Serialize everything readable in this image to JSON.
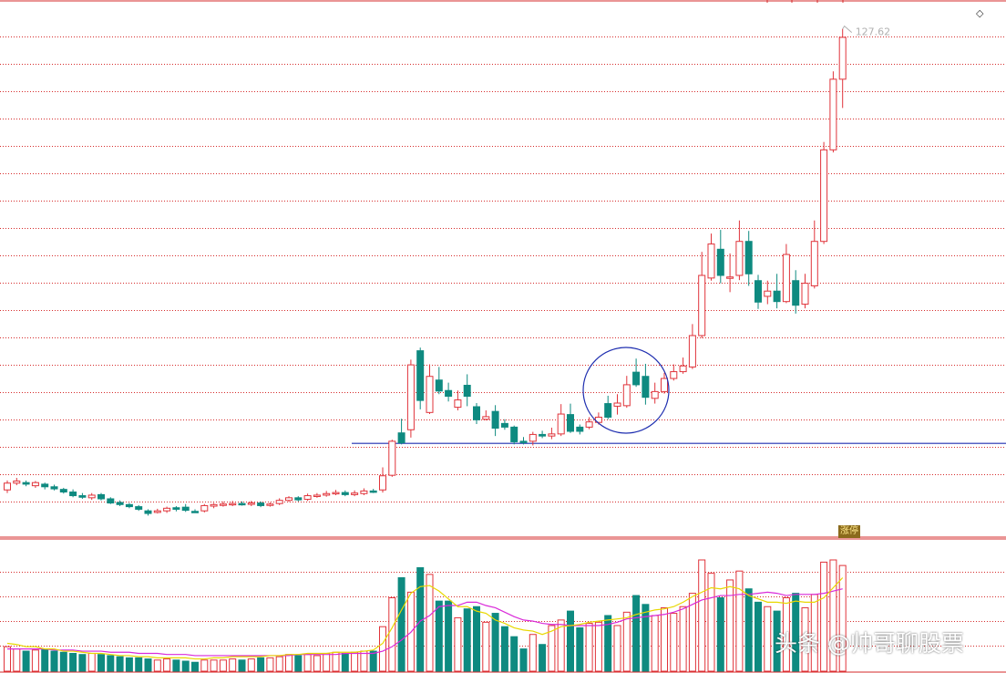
{
  "colors": {
    "up": "#e0333a",
    "down": "#0e8a80",
    "grid": "#d62b2b",
    "ma_fast": "#e8d800",
    "ma_slow": "#d92ad9",
    "support": "#1f2fb0",
    "circle": "#1f2fb0"
  },
  "price_axis": {
    "min": 31,
    "max": 130
  },
  "volume_axis": {
    "max": 100
  },
  "annotations": {
    "high_label": "127.62",
    "badge": "涨停",
    "watermark": "头条 @帅哥聊股票",
    "support_level": 48.4
  },
  "chart_data": {
    "type": "candlestick",
    "title": "",
    "ylim": [
      31,
      130
    ],
    "grid": true,
    "max_price_label": "127.62",
    "candles": [
      [
        39.5,
        40.8,
        41.3,
        38.9,
        22,
        "up"
      ],
      [
        40.8,
        41.2,
        41.8,
        40.4,
        20,
        "up"
      ],
      [
        40.9,
        40.6,
        41.3,
        40.2,
        18,
        "down"
      ],
      [
        40.3,
        40.9,
        41.2,
        39.9,
        19,
        "up"
      ],
      [
        40.6,
        40.1,
        40.9,
        39.6,
        20,
        "down"
      ],
      [
        40.1,
        39.7,
        40.5,
        39.4,
        18,
        "down"
      ],
      [
        39.6,
        39.1,
        39.9,
        38.8,
        17,
        "down"
      ],
      [
        39.1,
        38.4,
        39.6,
        38.1,
        16,
        "down"
      ],
      [
        38.4,
        38.1,
        38.9,
        37.8,
        15,
        "down"
      ],
      [
        38.0,
        38.5,
        38.9,
        37.6,
        16,
        "up"
      ],
      [
        38.6,
        37.8,
        38.9,
        37.5,
        15,
        "down"
      ],
      [
        37.8,
        37.0,
        38.1,
        36.8,
        14,
        "down"
      ],
      [
        37.1,
        36.7,
        37.5,
        36.4,
        13,
        "down"
      ],
      [
        36.7,
        36.3,
        37.0,
        36.0,
        12,
        "down"
      ],
      [
        36.3,
        35.8,
        36.6,
        35.5,
        12,
        "down"
      ],
      [
        35.5,
        35.0,
        35.8,
        34.6,
        11,
        "down"
      ],
      [
        35.2,
        35.5,
        35.9,
        35.0,
        10,
        "up"
      ],
      [
        35.5,
        36.0,
        36.3,
        35.1,
        11,
        "up"
      ],
      [
        36.1,
        35.8,
        36.4,
        35.4,
        10,
        "down"
      ],
      [
        36.2,
        35.6,
        36.8,
        35.3,
        9,
        "down"
      ],
      [
        35.4,
        35.4,
        35.8,
        35.1,
        8,
        "down"
      ],
      [
        35.5,
        36.5,
        36.8,
        35.2,
        10,
        "up"
      ],
      [
        36.4,
        36.7,
        37.0,
        36.0,
        10,
        "up"
      ],
      [
        36.7,
        36.8,
        37.3,
        36.3,
        10,
        "up"
      ],
      [
        36.8,
        36.9,
        37.4,
        36.4,
        11,
        "up"
      ],
      [
        36.9,
        36.8,
        37.3,
        36.5,
        10,
        "down"
      ],
      [
        36.8,
        37.0,
        37.4,
        36.4,
        11,
        "up"
      ],
      [
        37.0,
        36.5,
        37.3,
        36.2,
        12,
        "down"
      ],
      [
        36.6,
        36.8,
        37.1,
        36.3,
        12,
        "up"
      ],
      [
        36.9,
        37.5,
        37.9,
        36.6,
        13,
        "up"
      ],
      [
        37.5,
        38.0,
        38.3,
        37.2,
        15,
        "up"
      ],
      [
        38.0,
        37.6,
        38.3,
        37.3,
        14,
        "down"
      ],
      [
        37.7,
        38.4,
        38.8,
        37.4,
        15,
        "up"
      ],
      [
        38.4,
        38.5,
        38.9,
        38.0,
        14,
        "up"
      ],
      [
        38.5,
        38.8,
        39.3,
        38.2,
        16,
        "up"
      ],
      [
        38.8,
        39.0,
        39.5,
        38.5,
        17,
        "up"
      ],
      [
        39.0,
        38.6,
        39.4,
        38.3,
        16,
        "down"
      ],
      [
        38.6,
        38.9,
        39.4,
        38.3,
        17,
        "up"
      ],
      [
        38.8,
        39.3,
        39.8,
        38.5,
        18,
        "up"
      ],
      [
        39.3,
        39.2,
        39.7,
        38.9,
        18,
        "down"
      ],
      [
        39.5,
        42.2,
        43.8,
        39.0,
        40,
        "up"
      ],
      [
        42.3,
        48.8,
        49.1,
        42.0,
        66,
        "up"
      ],
      [
        48.5,
        50.4,
        53.1,
        48.2,
        84,
        "down"
      ],
      [
        51.0,
        63.4,
        64.4,
        49.5,
        71,
        "up"
      ],
      [
        56.6,
        66.1,
        66.7,
        54.9,
        93,
        "down"
      ],
      [
        54.3,
        61.2,
        63.5,
        54.0,
        87,
        "up"
      ],
      [
        60.5,
        58.4,
        63.0,
        57.8,
        63,
        "down"
      ],
      [
        58.5,
        57.4,
        60.0,
        56.4,
        63,
        "down"
      ],
      [
        55.3,
        56.7,
        58.5,
        54.7,
        48,
        "up"
      ],
      [
        57.4,
        59.5,
        61.6,
        55.5,
        56,
        "down"
      ],
      [
        55.4,
        52.9,
        56.1,
        52.1,
        58,
        "down"
      ],
      [
        53.0,
        53.5,
        54.7,
        52.8,
        44,
        "up"
      ],
      [
        54.5,
        51.3,
        55.7,
        49.8,
        52,
        "down"
      ],
      [
        52.2,
        51.5,
        53.0,
        51.0,
        40,
        "down"
      ],
      [
        51.5,
        48.7,
        51.8,
        48.2,
        31,
        "down"
      ],
      [
        48.8,
        48.8,
        49.6,
        48.2,
        20,
        "down"
      ],
      [
        48.8,
        50.1,
        50.6,
        48.0,
        33,
        "up"
      ],
      [
        50.1,
        49.8,
        50.8,
        49.4,
        24,
        "down"
      ],
      [
        49.8,
        50.2,
        51.4,
        49.2,
        41,
        "up"
      ],
      [
        50.2,
        54.0,
        55.9,
        49.8,
        46,
        "up"
      ],
      [
        53.9,
        50.7,
        56.0,
        50.4,
        54,
        "down"
      ],
      [
        50.7,
        51.5,
        52.0,
        50.1,
        39,
        "down"
      ],
      [
        51.5,
        52.5,
        53.4,
        51.1,
        43,
        "up"
      ],
      [
        52.4,
        53.4,
        54.3,
        52.0,
        44,
        "up"
      ],
      [
        53.4,
        56.0,
        57.5,
        53.0,
        50,
        "down"
      ],
      [
        56.1,
        55.5,
        57.8,
        53.9,
        41,
        "up"
      ],
      [
        55.6,
        59.6,
        61.3,
        55.2,
        53,
        "up"
      ],
      [
        59.6,
        62.0,
        64.6,
        59.2,
        68,
        "down"
      ],
      [
        61.2,
        57.2,
        63.6,
        55.8,
        60,
        "down"
      ],
      [
        57.0,
        58.3,
        60.0,
        56.0,
        50,
        "up"
      ],
      [
        58.3,
        60.8,
        61.9,
        57.9,
        57,
        "up"
      ],
      [
        60.8,
        62.1,
        63.5,
        60.4,
        52,
        "up"
      ],
      [
        62.1,
        63.2,
        64.8,
        61.7,
        58,
        "up"
      ],
      [
        63.0,
        69.0,
        71.2,
        62.6,
        70,
        "up"
      ],
      [
        69.0,
        80.5,
        85.0,
        68.5,
        100,
        "up"
      ],
      [
        80.0,
        86.5,
        88.5,
        79.5,
        88,
        "up"
      ],
      [
        85.5,
        80.5,
        89.2,
        79.0,
        66,
        "down"
      ],
      [
        80.0,
        80.2,
        84.7,
        77.3,
        82,
        "up"
      ],
      [
        80.5,
        87.0,
        91.0,
        79.6,
        90,
        "up"
      ],
      [
        87.0,
        80.8,
        89.0,
        78.5,
        74,
        "down"
      ],
      [
        79.5,
        75.4,
        80.6,
        74.1,
        62,
        "down"
      ],
      [
        76.5,
        77.5,
        79.5,
        75.0,
        58,
        "up"
      ],
      [
        77.5,
        75.5,
        80.8,
        74.2,
        54,
        "down"
      ],
      [
        75.5,
        84.5,
        86.5,
        75.2,
        66,
        "up"
      ],
      [
        79.5,
        74.8,
        81.5,
        73.2,
        70,
        "down"
      ],
      [
        75.0,
        79.0,
        80.8,
        74.2,
        57,
        "up"
      ],
      [
        78.5,
        87.0,
        91.0,
        78.0,
        69,
        "up"
      ],
      [
        87.0,
        104.5,
        106.0,
        86.5,
        98,
        "up"
      ],
      [
        104.5,
        118.0,
        119.5,
        104.0,
        100,
        "up"
      ],
      [
        118.0,
        126.0,
        127.62,
        112.5,
        95,
        "up"
      ]
    ],
    "ma_fast": [
      25,
      24,
      22,
      22,
      20,
      20,
      18,
      18,
      17,
      16,
      16,
      15,
      14,
      14,
      13,
      13,
      12,
      12,
      12,
      12,
      11,
      11,
      12,
      12,
      13,
      13,
      13,
      13,
      14,
      14,
      15,
      15,
      16,
      16,
      16,
      17,
      17,
      17,
      18,
      19,
      25,
      39,
      55,
      70,
      76,
      77,
      72,
      65,
      58,
      58,
      54,
      52,
      46,
      43,
      39,
      37,
      36,
      33,
      36,
      40,
      41,
      42,
      44,
      45,
      46,
      47,
      48,
      51,
      53,
      55,
      56,
      58,
      62,
      67,
      71,
      75,
      74,
      76,
      74,
      68,
      65,
      62,
      62,
      61,
      63,
      62,
      62,
      66,
      75,
      84
    ],
    "ma_slow": [
      20,
      20,
      20,
      20,
      20,
      19,
      19,
      19,
      18,
      18,
      18,
      17,
      17,
      17,
      16,
      16,
      16,
      15,
      15,
      15,
      14,
      14,
      14,
      14,
      14,
      14,
      14,
      14,
      14,
      14,
      14,
      15,
      15,
      15,
      15,
      15,
      16,
      16,
      16,
      16,
      18,
      22,
      28,
      35,
      45,
      50,
      58,
      59,
      59,
      62,
      62,
      59,
      57,
      53,
      49,
      46,
      45,
      43,
      42,
      42,
      41,
      41,
      41,
      41,
      42,
      44,
      47,
      48,
      49,
      50,
      51,
      53,
      56,
      60,
      64,
      66,
      68,
      68,
      69,
      69,
      70,
      71,
      70,
      68,
      69,
      69,
      69,
      70,
      72,
      74
    ]
  }
}
